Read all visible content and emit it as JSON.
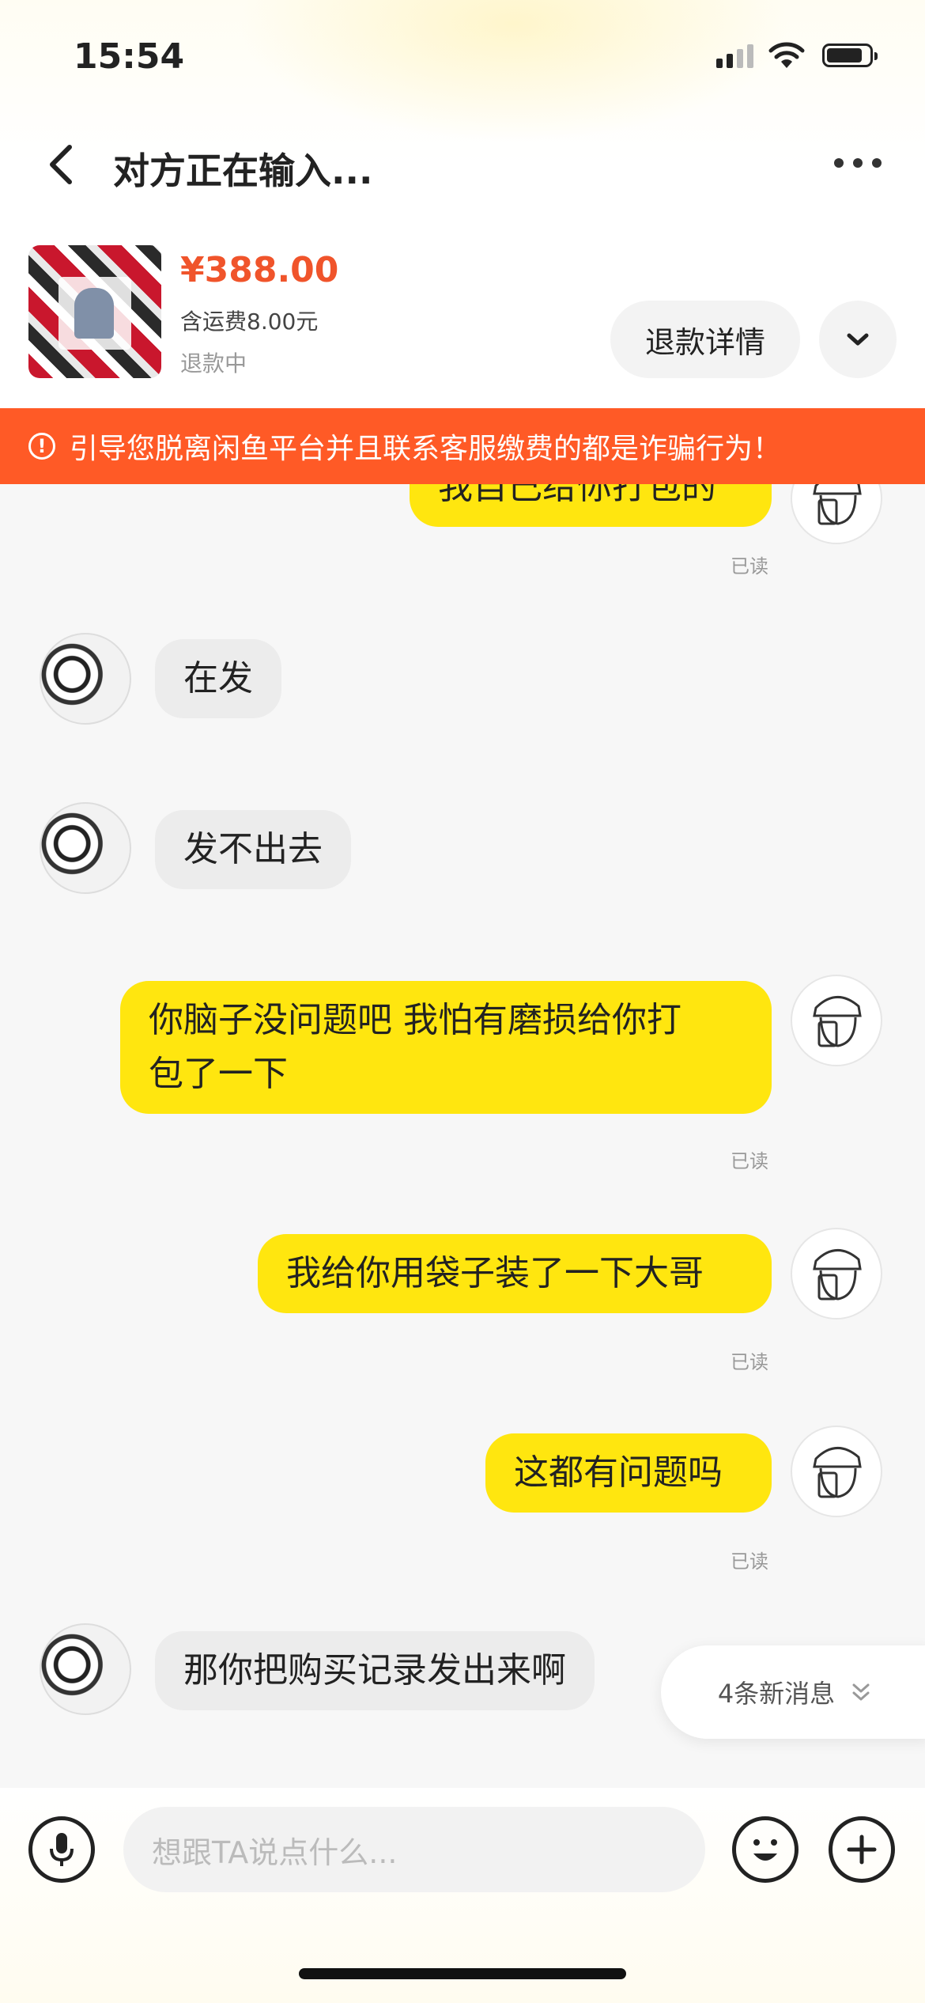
{
  "status_bar": {
    "time": "15:54"
  },
  "nav": {
    "title": "对方正在输入..."
  },
  "product": {
    "price": "¥388.00",
    "shipping": "含运费8.00元",
    "status": "退款中",
    "refund_button": "退款详情"
  },
  "warning": {
    "text": "引导您脱离闲鱼平台并且联系客服缴费的都是诈骗行为！",
    "color": "#ff5a26"
  },
  "messages": [
    {
      "side": "self",
      "text": "我自己给你打包的",
      "read": "已读"
    },
    {
      "side": "other",
      "text": "在发"
    },
    {
      "side": "other",
      "text": "发不出去"
    },
    {
      "side": "self",
      "text_line1": "你脑子没问题吧 我怕有磨损给你打",
      "text_line2": "包了一下",
      "read": "已读"
    },
    {
      "side": "self",
      "text": "我给你用袋子装了一下大哥",
      "read": "已读"
    },
    {
      "side": "self",
      "text": "这都有问题吗",
      "read": "已读"
    },
    {
      "side": "other",
      "text": "那你把购买记录发出来啊"
    }
  ],
  "new_messages": {
    "label": "4条新消息"
  },
  "composer": {
    "placeholder": "想跟TA说点什么..."
  },
  "colors": {
    "accent": "#ffe60f",
    "price": "#f0542b"
  }
}
